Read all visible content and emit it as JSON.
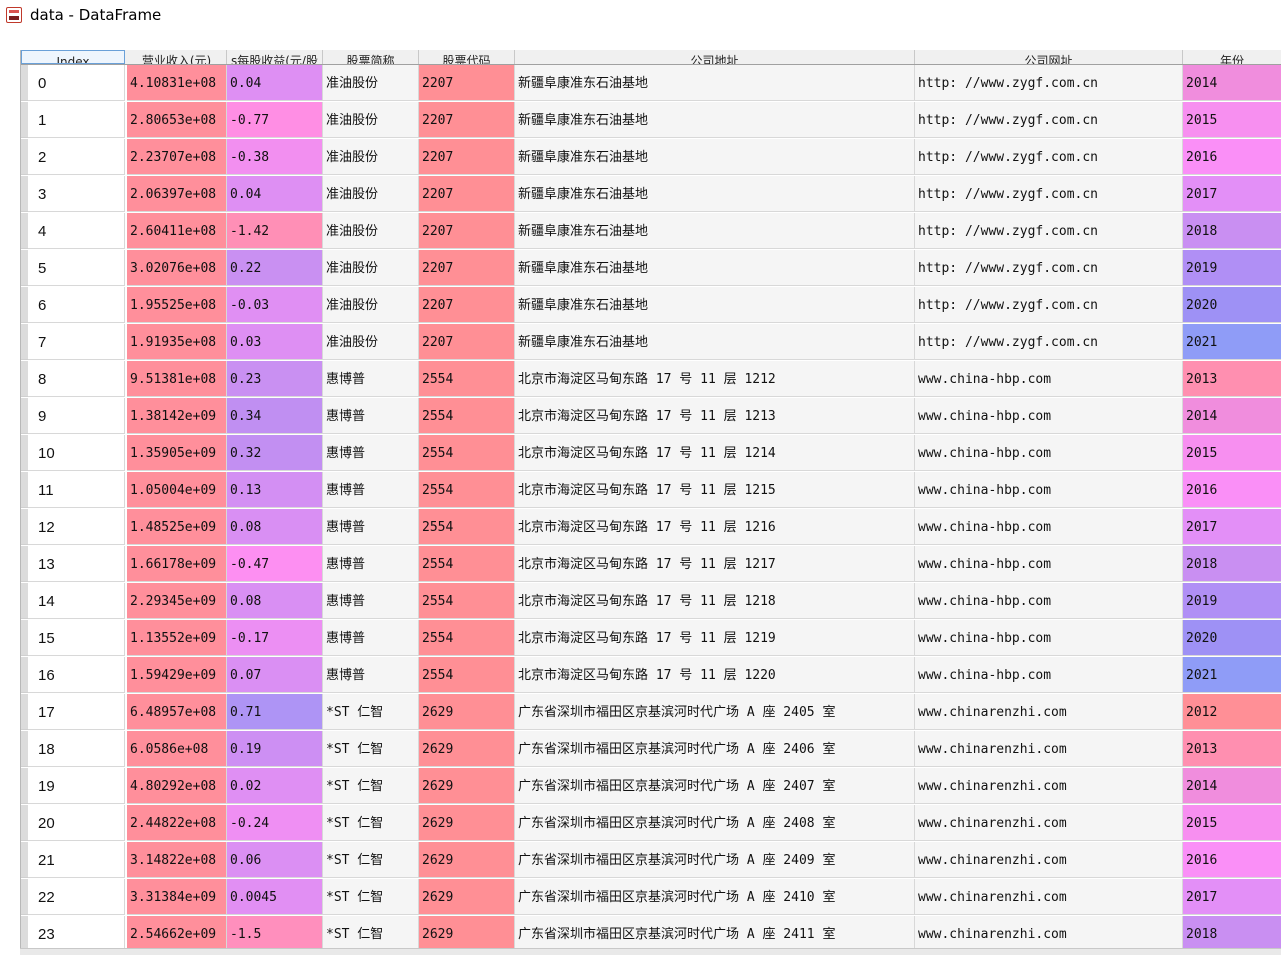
{
  "window": {
    "title": "data - DataFrame",
    "icon": "spyder-variable-icon"
  },
  "columns": [
    {
      "key": "index",
      "label": "Index"
    },
    {
      "key": "revenue",
      "label": "营业收入(元)"
    },
    {
      "key": "eps",
      "label": "s每股收益(元/股"
    },
    {
      "key": "short_name",
      "label": "股票简称"
    },
    {
      "key": "code",
      "label": "股票代码"
    },
    {
      "key": "address",
      "label": "公司地址"
    },
    {
      "key": "website",
      "label": "公司网址"
    },
    {
      "key": "year",
      "label": "年份"
    }
  ],
  "rows": [
    {
      "index": "0",
      "revenue": "4.10831e+08",
      "eps": "0.04",
      "short_name": "准油股份",
      "code": "2207",
      "address": "新疆阜康准东石油基地",
      "website": "http: //www.zygf.com.cn",
      "year": "2014",
      "revenue_color": "#ff8f9b",
      "eps_color": "#de8ff3",
      "code_color": "#ff8f95",
      "year_color": "#f08ddd"
    },
    {
      "index": "1",
      "revenue": "2.80653e+08",
      "eps": "-0.77",
      "short_name": "准油股份",
      "code": "2207",
      "address": "新疆阜康准东石油基地",
      "website": "http: //www.zygf.com.cn",
      "year": "2015",
      "revenue_color": "#ff8f9b",
      "eps_color": "#ff8ee4",
      "code_color": "#ff8f95",
      "year_color": "#f78ff0"
    },
    {
      "index": "2",
      "revenue": "2.23707e+08",
      "eps": "-0.38",
      "short_name": "准油股份",
      "code": "2207",
      "address": "新疆阜康准东石油基地",
      "website": "http: //www.zygf.com.cn",
      "year": "2016",
      "revenue_color": "#ff8f9b",
      "eps_color": "#f28ff0",
      "code_color": "#ff8f95",
      "year_color": "#fa8ff7"
    },
    {
      "index": "3",
      "revenue": "2.06397e+08",
      "eps": "0.04",
      "short_name": "准油股份",
      "code": "2207",
      "address": "新疆阜康准东石油基地",
      "website": "http: //www.zygf.com.cn",
      "year": "2017",
      "revenue_color": "#ff8f9b",
      "eps_color": "#de8ff3",
      "code_color": "#ff8f95",
      "year_color": "#e38ff7"
    },
    {
      "index": "4",
      "revenue": "2.60411e+08",
      "eps": "-1.42",
      "short_name": "准油股份",
      "code": "2207",
      "address": "新疆阜康准东石油基地",
      "website": "http: //www.zygf.com.cn",
      "year": "2018",
      "revenue_color": "#ff8f9b",
      "eps_color": "#ff8fb6",
      "code_color": "#ff8f95",
      "year_color": "#c98ff2"
    },
    {
      "index": "5",
      "revenue": "3.02076e+08",
      "eps": "0.22",
      "short_name": "准油股份",
      "code": "2207",
      "address": "新疆阜康准东石油基地",
      "website": "http: //www.zygf.com.cn",
      "year": "2019",
      "revenue_color": "#ff8f9b",
      "eps_color": "#c990f2",
      "code_color": "#ff8f95",
      "year_color": "#b08ff5"
    },
    {
      "index": "6",
      "revenue": "1.95525e+08",
      "eps": "-0.03",
      "short_name": "准油股份",
      "code": "2207",
      "address": "新疆阜康准东石油基地",
      "website": "http: //www.zygf.com.cn",
      "year": "2020",
      "revenue_color": "#ff8f9b",
      "eps_color": "#e08ff3",
      "code_color": "#ff8f95",
      "year_color": "#9e91f5"
    },
    {
      "index": "7",
      "revenue": "1.91935e+08",
      "eps": "0.03",
      "short_name": "准油股份",
      "code": "2207",
      "address": "新疆阜康准东石油基地",
      "website": "http: //www.zygf.com.cn",
      "year": "2021",
      "revenue_color": "#ff8f9b",
      "eps_color": "#de8ff3",
      "code_color": "#ff8f95",
      "year_color": "#8f9cf7"
    },
    {
      "index": "8",
      "revenue": "9.51381e+08",
      "eps": "0.23",
      "short_name": "惠博普",
      "code": "2554",
      "address": "北京市海淀区马甸东路 17 号 11 层 1212",
      "website": "www.china-hbp.com",
      "year": "2013",
      "revenue_color": "#ff8f9b",
      "eps_color": "#c990f2",
      "code_color": "#ff8f95",
      "year_color": "#ff8fb0"
    },
    {
      "index": "9",
      "revenue": "1.38142e+09",
      "eps": "0.34",
      "short_name": "惠博普",
      "code": "2554",
      "address": "北京市海淀区马甸东路 17 号 11 层 1213",
      "website": "www.china-hbp.com",
      "year": "2014",
      "revenue_color": "#ff8f9b",
      "eps_color": "#c08ff2",
      "code_color": "#ff8f95",
      "year_color": "#f08ddd"
    },
    {
      "index": "10",
      "revenue": "1.35905e+09",
      "eps": "0.32",
      "short_name": "惠博普",
      "code": "2554",
      "address": "北京市海淀区马甸东路 17 号 11 层 1214",
      "website": "www.china-hbp.com",
      "year": "2015",
      "revenue_color": "#ff8f9b",
      "eps_color": "#c28ff2",
      "code_color": "#ff8f95",
      "year_color": "#f78ff0"
    },
    {
      "index": "11",
      "revenue": "1.05004e+09",
      "eps": "0.13",
      "short_name": "惠博普",
      "code": "2554",
      "address": "北京市海淀区马甸东路 17 号 11 层 1215",
      "website": "www.china-hbp.com",
      "year": "2016",
      "revenue_color": "#ff8f9b",
      "eps_color": "#d38ff3",
      "code_color": "#ff8f95",
      "year_color": "#fa8ff7"
    },
    {
      "index": "12",
      "revenue": "1.48525e+09",
      "eps": "0.08",
      "short_name": "惠博普",
      "code": "2554",
      "address": "北京市海淀区马甸东路 17 号 11 层 1216",
      "website": "www.china-hbp.com",
      "year": "2017",
      "revenue_color": "#ff8f9b",
      "eps_color": "#d98ff3",
      "code_color": "#ff8f95",
      "year_color": "#e38ff7"
    },
    {
      "index": "13",
      "revenue": "1.66178e+09",
      "eps": "-0.47",
      "short_name": "惠博普",
      "code": "2554",
      "address": "北京市海淀区马甸东路 17 号 11 层 1217",
      "website": "www.china-hbp.com",
      "year": "2018",
      "revenue_color": "#ff8f9b",
      "eps_color": "#fd8ff2",
      "code_color": "#ff8f95",
      "year_color": "#c98ff2"
    },
    {
      "index": "14",
      "revenue": "2.29345e+09",
      "eps": "0.08",
      "short_name": "惠博普",
      "code": "2554",
      "address": "北京市海淀区马甸东路 17 号 11 层 1218",
      "website": "www.china-hbp.com",
      "year": "2019",
      "revenue_color": "#ff8f9b",
      "eps_color": "#d98ff3",
      "code_color": "#ff8f95",
      "year_color": "#b08ff5"
    },
    {
      "index": "15",
      "revenue": "1.13552e+09",
      "eps": "-0.17",
      "short_name": "惠博普",
      "code": "2554",
      "address": "北京市海淀区马甸东路 17 号 11 层 1219",
      "website": "www.china-hbp.com",
      "year": "2020",
      "revenue_color": "#ff8f9b",
      "eps_color": "#ec8ff3",
      "code_color": "#ff8f95",
      "year_color": "#9e91f5"
    },
    {
      "index": "16",
      "revenue": "1.59429e+09",
      "eps": "0.07",
      "short_name": "惠博普",
      "code": "2554",
      "address": "北京市海淀区马甸东路 17 号 11 层 1220",
      "website": "www.china-hbp.com",
      "year": "2021",
      "revenue_color": "#ff8f9b",
      "eps_color": "#da8ff3",
      "code_color": "#ff8f95",
      "year_color": "#8f9cf7"
    },
    {
      "index": "17",
      "revenue": "6.48957e+08",
      "eps": "0.71",
      "short_name": "*ST 仁智",
      "code": "2629",
      "address": "广东省深圳市福田区京基滨河时代广场 A 座 2405 室",
      "website": "www.chinarenzhi.com",
      "year": "2012",
      "revenue_color": "#ff8f9b",
      "eps_color": "#ae94f5",
      "code_color": "#ff8f95",
      "year_color": "#ff8f96"
    },
    {
      "index": "18",
      "revenue": "6.0586e+08",
      "eps": "0.19",
      "short_name": "*ST 仁智",
      "code": "2629",
      "address": "广东省深圳市福田区京基滨河时代广场 A 座 2406 室",
      "website": "www.chinarenzhi.com",
      "year": "2013",
      "revenue_color": "#ff8f9b",
      "eps_color": "#cd8ff3",
      "code_color": "#ff8f95",
      "year_color": "#ff8fb0"
    },
    {
      "index": "19",
      "revenue": "4.80292e+08",
      "eps": "0.02",
      "short_name": "*ST 仁智",
      "code": "2629",
      "address": "广东省深圳市福田区京基滨河时代广场 A 座 2407 室",
      "website": "www.chinarenzhi.com",
      "year": "2014",
      "revenue_color": "#ff8f9b",
      "eps_color": "#df8ff3",
      "code_color": "#ff8f95",
      "year_color": "#f08ddd"
    },
    {
      "index": "20",
      "revenue": "2.44822e+08",
      "eps": "-0.24",
      "short_name": "*ST 仁智",
      "code": "2629",
      "address": "广东省深圳市福田区京基滨河时代广场 A 座 2408 室",
      "website": "www.chinarenzhi.com",
      "year": "2015",
      "revenue_color": "#ff8f9b",
      "eps_color": "#ef8ff3",
      "code_color": "#ff8f95",
      "year_color": "#f78ff0"
    },
    {
      "index": "21",
      "revenue": "3.14822e+08",
      "eps": "0.06",
      "short_name": "*ST 仁智",
      "code": "2629",
      "address": "广东省深圳市福田区京基滨河时代广场 A 座 2409 室",
      "website": "www.chinarenzhi.com",
      "year": "2016",
      "revenue_color": "#ff8f9b",
      "eps_color": "#db8ff3",
      "code_color": "#ff8f95",
      "year_color": "#fa8ff7"
    },
    {
      "index": "22",
      "revenue": "3.31384e+09",
      "eps": "0.0045",
      "short_name": "*ST 仁智",
      "code": "2629",
      "address": "广东省深圳市福田区京基滨河时代广场 A 座 2410 室",
      "website": "www.chinarenzhi.com",
      "year": "2017",
      "revenue_color": "#ff8f9b",
      "eps_color": "#e18ff3",
      "code_color": "#ff8f95",
      "year_color": "#e38ff7"
    },
    {
      "index": "23",
      "revenue": "2.54662e+09",
      "eps": "-1.5",
      "short_name": "*ST 仁智",
      "code": "2629",
      "address": "广东省深圳市福田区京基滨河时代广场 A 座 2411 室",
      "website": "www.chinarenzhi.com",
      "year": "2018",
      "revenue_color": "#ff8f9b",
      "eps_color": "#ff8fbd",
      "code_color": "#ff8f95",
      "year_color": "#c98ff2"
    }
  ]
}
